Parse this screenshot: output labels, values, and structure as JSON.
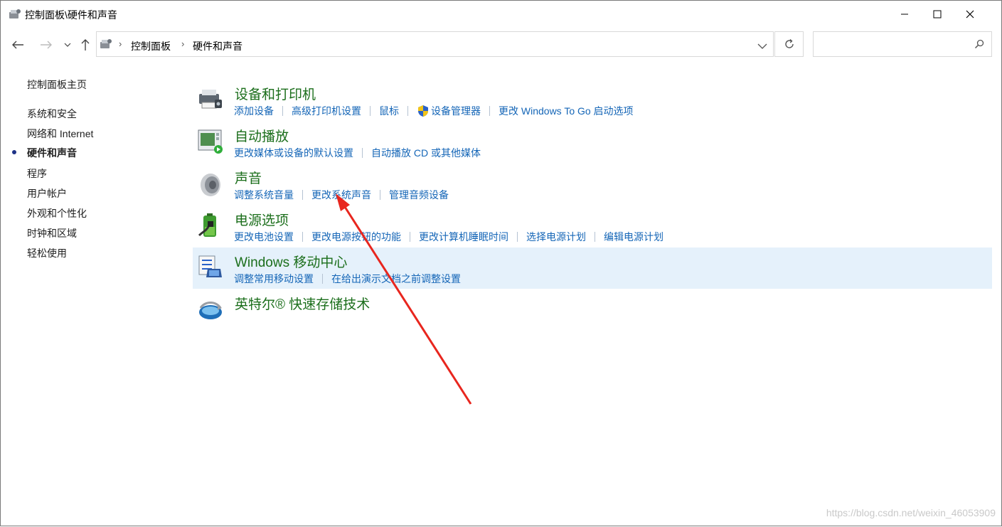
{
  "window": {
    "title": "控制面板\\硬件和声音"
  },
  "breadcrumb": {
    "items": [
      "控制面板",
      "硬件和声音"
    ]
  },
  "search": {
    "placeholder": ""
  },
  "sidebar": {
    "home": "控制面板主页",
    "items": [
      {
        "label": "系统和安全",
        "active": false
      },
      {
        "label": "网络和 Internet",
        "active": false
      },
      {
        "label": "硬件和声音",
        "active": true
      },
      {
        "label": "程序",
        "active": false
      },
      {
        "label": "用户帐户",
        "active": false
      },
      {
        "label": "外观和个性化",
        "active": false
      },
      {
        "label": "时钟和区域",
        "active": false
      },
      {
        "label": "轻松使用",
        "active": false
      }
    ]
  },
  "categories": [
    {
      "title": "设备和打印机",
      "icon": "devices-printers-icon",
      "links": [
        "添加设备",
        "高级打印机设置",
        "鼠标",
        "设备管理器",
        "更改 Windows To Go 启动选项"
      ]
    },
    {
      "title": "自动播放",
      "icon": "autoplay-icon",
      "links": [
        "更改媒体或设备的默认设置",
        "自动播放 CD 或其他媒体"
      ]
    },
    {
      "title": "声音",
      "icon": "speaker-icon",
      "links": [
        "调整系统音量",
        "更改系统声音",
        "管理音频设备"
      ]
    },
    {
      "title": "电源选项",
      "icon": "battery-icon",
      "links": [
        "更改电池设置",
        "更改电源按钮的功能",
        "更改计算机睡眠时间",
        "选择电源计划",
        "编辑电源计划"
      ]
    },
    {
      "title": "Windows 移动中心",
      "icon": "mobility-center-icon",
      "links": [
        "调整常用移动设置",
        "在给出演示文档之前调整设置"
      ]
    },
    {
      "title": "英特尔® 快速存储技术",
      "icon": "intel-rst-icon",
      "links": []
    }
  ],
  "watermark": "https://blog.csdn.net/weixin_46053909",
  "colors": {
    "link": "#1566b7",
    "category_title": "#1b6e1b",
    "highlight": "#e5f1fb",
    "annotation_arrow": "#e8261e"
  }
}
